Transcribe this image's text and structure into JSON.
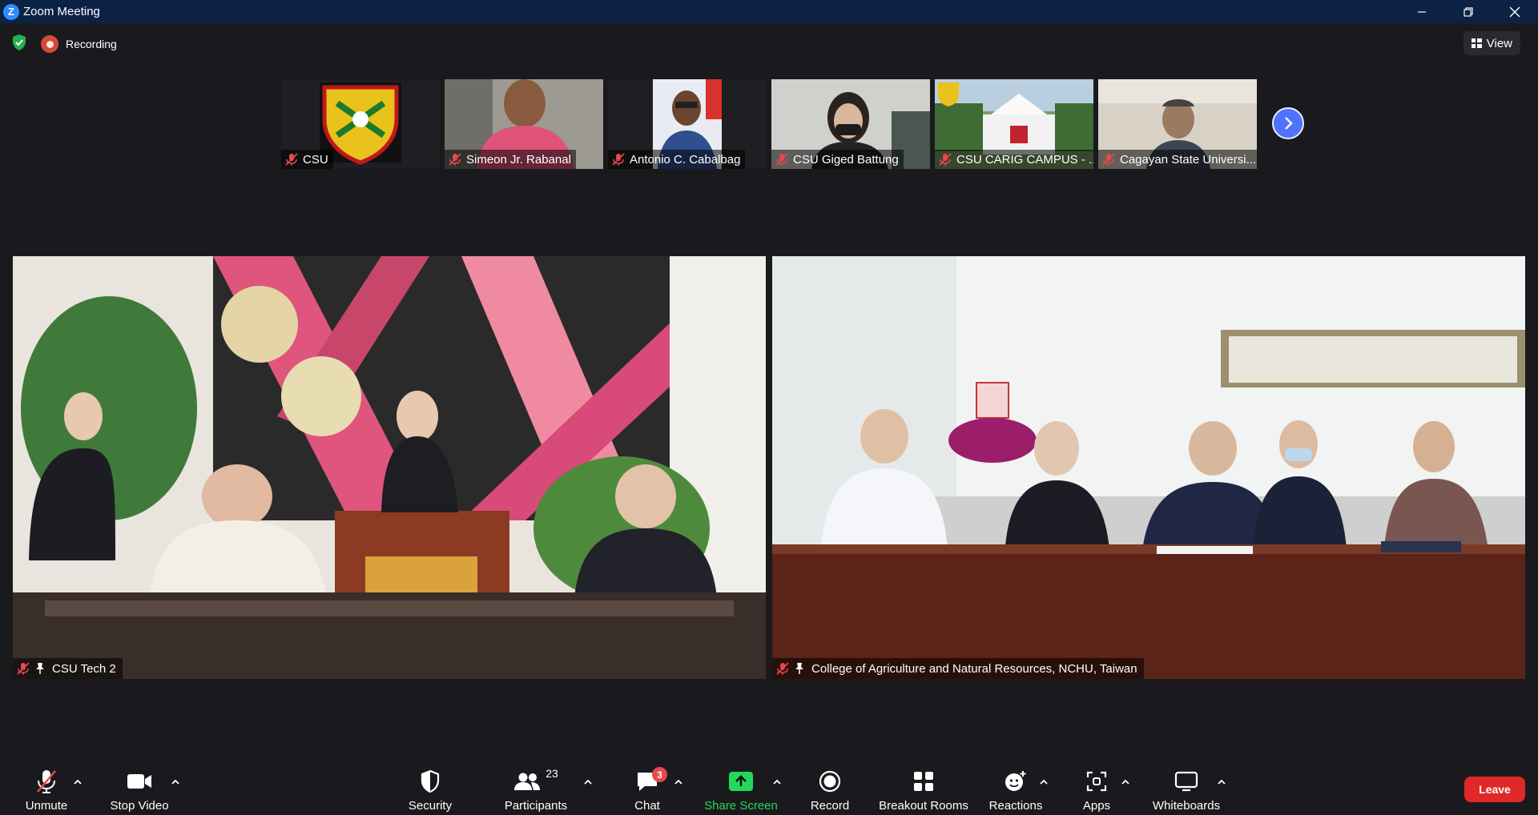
{
  "window": {
    "title": "Zoom Meeting",
    "app_icon": "zoom-logo-icon",
    "app_icon_letter": "Z"
  },
  "infobar": {
    "security_icon": "shield-check-icon",
    "recording_label": "Recording",
    "view_label": "View"
  },
  "thumbnails": [
    {
      "name": "CSU",
      "muted": true
    },
    {
      "name": "Simeon Jr. Rabanal",
      "muted": true
    },
    {
      "name": "Antonio C. Cabalbag",
      "muted": true
    },
    {
      "name": "CSU Giged Battung",
      "muted": true
    },
    {
      "name": "CSU CARIG CAMPUS - ...",
      "muted": true
    },
    {
      "name": "Cagayan State Universi...",
      "muted": true
    }
  ],
  "main_videos": [
    {
      "name": "CSU Tech 2",
      "muted": true,
      "pinned": true
    },
    {
      "name": "College of Agriculture and Natural Resources, NCHU, Taiwan",
      "muted": true,
      "pinned": true
    }
  ],
  "toolbar": {
    "unmute": "Unmute",
    "stop_video": "Stop Video",
    "security": "Security",
    "participants": "Participants",
    "participants_count": "23",
    "chat": "Chat",
    "chat_badge": "3",
    "share_screen": "Share Screen",
    "record": "Record",
    "breakout_rooms": "Breakout Rooms",
    "reactions": "Reactions",
    "apps": "Apps",
    "whiteboards": "Whiteboards",
    "leave": "Leave"
  },
  "colors": {
    "titlebar": "#0b2245",
    "background": "#1a1a1e",
    "accent_blue": "#4f73ff",
    "share_green": "#23d959",
    "leave_red": "#e02828",
    "mute_red": "#e5484d"
  }
}
